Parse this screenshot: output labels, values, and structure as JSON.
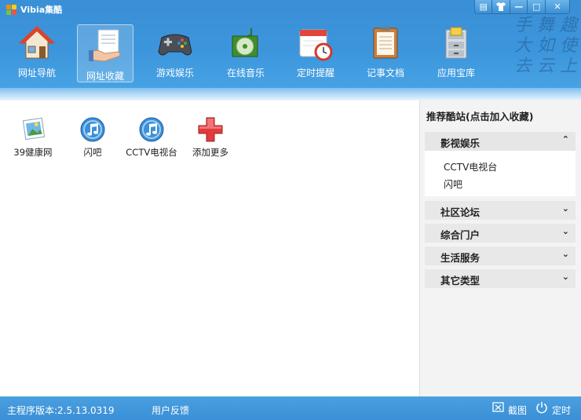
{
  "app": {
    "title": "Vibia集酷"
  },
  "window_controls": {
    "skin_icon": "skin-icon",
    "minimize": "—",
    "maximize": "□",
    "close": "✕"
  },
  "toolbar": {
    "items": [
      {
        "label": "网址导航",
        "icon": "home-icon"
      },
      {
        "label": "网址收藏",
        "icon": "favorites-icon"
      },
      {
        "label": "游戏娱乐",
        "icon": "gamepad-icon"
      },
      {
        "label": "在线音乐",
        "icon": "music-cd-icon"
      },
      {
        "label": "定时提醒",
        "icon": "calendar-clock-icon"
      },
      {
        "label": "记事文档",
        "icon": "notepad-icon"
      },
      {
        "label": "应用宝库",
        "icon": "cabinet-icon"
      }
    ],
    "active_index": 1
  },
  "favorites": [
    {
      "label": "39健康网",
      "icon": "image-icon"
    },
    {
      "label": "闪吧",
      "icon": "music-note-icon"
    },
    {
      "label": "CCTV电视台",
      "icon": "music-note-icon"
    },
    {
      "label": "添加更多",
      "icon": "add-icon"
    }
  ],
  "panel": {
    "title": "推荐酷站(点击加入收藏)",
    "categories": [
      {
        "label": "影视娱乐",
        "expanded": true,
        "items": [
          "CCTV电视台",
          "闪吧"
        ]
      },
      {
        "label": "社区论坛",
        "expanded": false
      },
      {
        "label": "综合门户",
        "expanded": false
      },
      {
        "label": "生活服务",
        "expanded": false
      },
      {
        "label": "其它类型",
        "expanded": false
      }
    ]
  },
  "status": {
    "version": "主程序版本:2.5.13.0319",
    "feedback": "用户反馈",
    "screenshot": "截图",
    "timer": "定时"
  },
  "colors": {
    "accent": "#3c95db",
    "panel_bg": "#f3f3f3",
    "add_icon": "#e23b3b"
  }
}
